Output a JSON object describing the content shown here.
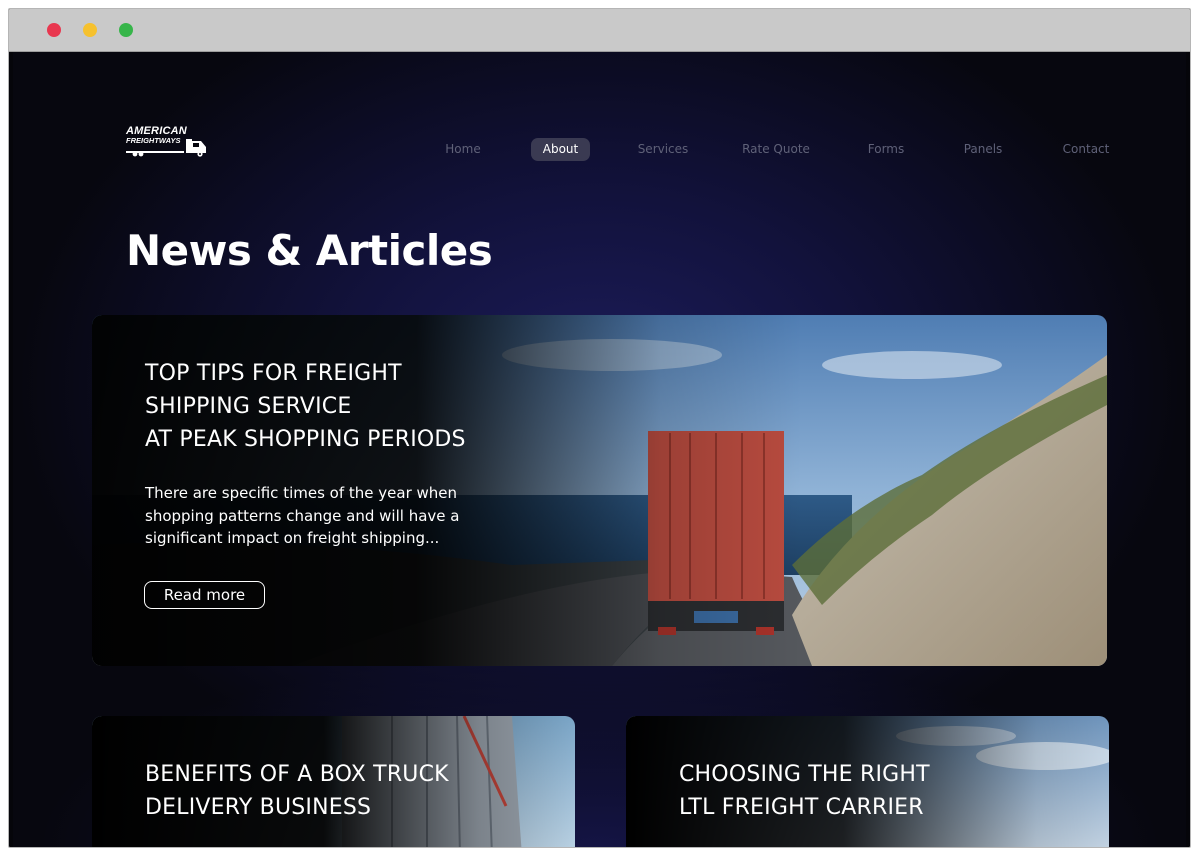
{
  "brand": {
    "line1": "AMERICAN",
    "line2": "FREIGHTWAYS"
  },
  "nav": {
    "items": [
      {
        "label": "Home"
      },
      {
        "label": "About"
      },
      {
        "label": "Services"
      },
      {
        "label": "Rate Quote"
      },
      {
        "label": "Forms"
      },
      {
        "label": "Panels"
      },
      {
        "label": "Contact"
      }
    ],
    "active": "About"
  },
  "page_title": "News & Articles",
  "featured": {
    "title_lines": [
      "TOP TIPS FOR FREIGHT",
      "SHIPPING SERVICE",
      "AT PEAK SHOPPING PERIODS"
    ],
    "excerpt_lines": [
      "There are specific times of the year when",
      "shopping patterns change and will have a",
      "significant impact on freight shipping..."
    ],
    "button_label": "Read more"
  },
  "articles": [
    {
      "title_lines": [
        "BENEFITS OF A BOX TRUCK",
        "DELIVERY BUSINESS"
      ]
    },
    {
      "title_lines": [
        "CHOOSING THE RIGHT",
        "LTL FREIGHT CARRIER"
      ]
    }
  ],
  "colors": {
    "background": "#07070f",
    "glow": "#1c1c5a",
    "nav_text": "#5f6178",
    "nav_active_bg": "#3a3a52",
    "window_close": "#e8374f",
    "window_minimize": "#f6c12e",
    "window_zoom": "#37b54a"
  },
  "icons": [
    "truck-logo-icon",
    "window-close-icon",
    "window-minimize-icon",
    "window-zoom-icon"
  ]
}
